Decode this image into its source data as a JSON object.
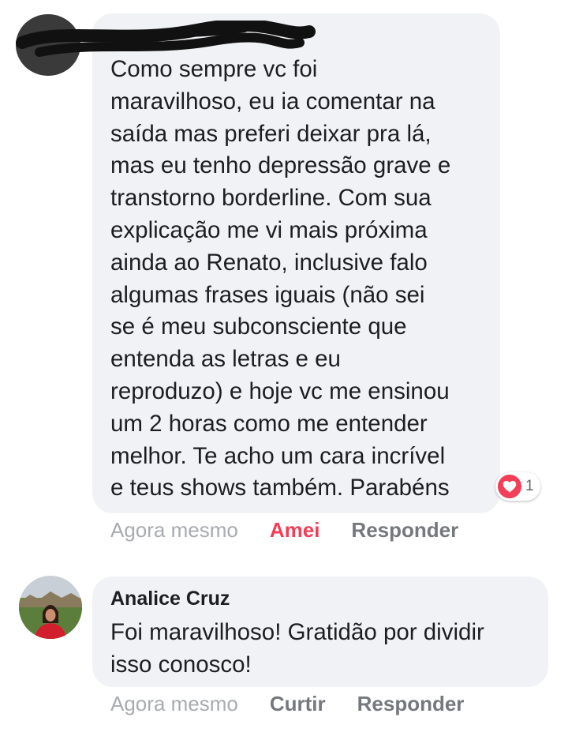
{
  "colors": {
    "bubble_bg": "#f0f2f5",
    "text": "#1c1e21",
    "secondary_text": "#65676b",
    "love_red": "#f33e58"
  },
  "comments": [
    {
      "author": "",
      "text": "Como sempre vc foi\nmaravilhoso, eu ia comentar na\nsaída mas preferi deixar pra lá,\nmas eu tenho depressão grave e\ntranstorno borderline. Com sua\nexplicação me vi mais próxima\nainda ao Renato, inclusive falo\nalgumas frases iguais (não sei\nse é meu subconsciente que\nentenda as letras e eu\nreproduzo) e hoje vc me ensinou\num 2 horas como me entender\nmelhor. Te acho um cara incrível\ne teus shows também. Parabéns",
      "reaction": {
        "icon": "heart-icon",
        "count": "1"
      },
      "timestamp": "Agora mesmo",
      "like_label": "Amei",
      "reply_label": "Responder"
    },
    {
      "author": "Analice Cruz",
      "text": "Foi maravilhoso! Gratidão por dividir\nisso conosco!",
      "timestamp": "Agora mesmo",
      "like_label": "Curtir",
      "reply_label": "Responder"
    }
  ]
}
